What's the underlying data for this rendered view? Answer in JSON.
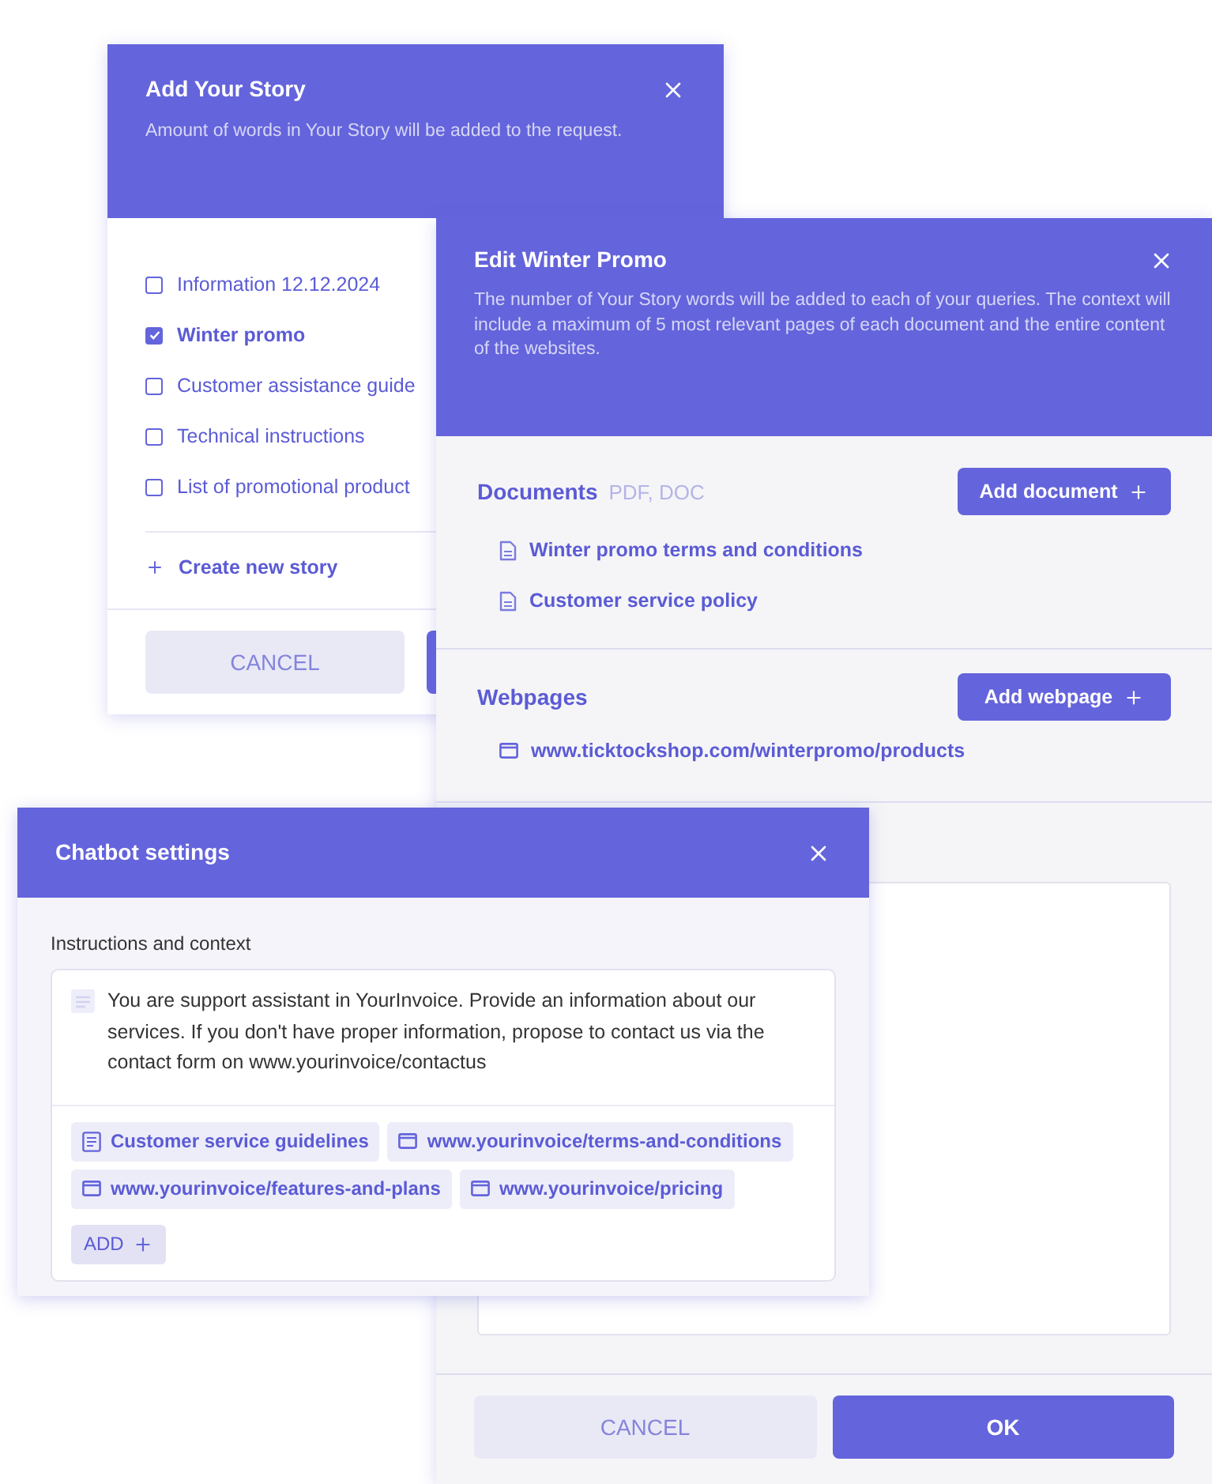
{
  "add_story_dialog": {
    "title": "Add Your Story",
    "description": "Amount of words in Your Story will be added to the request.",
    "stories": [
      {
        "label": "Information 12.12.2024",
        "checked": false
      },
      {
        "label": "Winter promo",
        "checked": true
      },
      {
        "label": "Customer assistance guide",
        "checked": false
      },
      {
        "label": "Technical instructions",
        "checked": false
      },
      {
        "label": "List of promotional product",
        "checked": false
      }
    ],
    "create_link": "Create new story",
    "buttons": [
      {
        "kind": "secondary",
        "label": "CANCEL"
      },
      {
        "kind": "primary"
      }
    ]
  },
  "edit_dialog": {
    "title": "Edit Winter Promo",
    "description": "The number of Your Story words will be added to each of your queries. The context will include a maximum of 5 most relevant pages of each document and the entire content of the websites.",
    "documents": {
      "heading": "Documents",
      "formats": "PDF, DOC",
      "button": "Add document",
      "items": [
        {
          "kind": "document",
          "label": "Winter promo terms and conditions"
        },
        {
          "kind": "document",
          "label": "Customer service policy"
        }
      ]
    },
    "webpages": {
      "heading": "Webpages",
      "button": "Add webpage",
      "items": [
        {
          "kind": "webpage",
          "label": "www.ticktockshop.com/winterpromo/products"
        }
      ]
    },
    "buttons": [
      {
        "kind": "secondary",
        "label": "CANCEL"
      },
      {
        "kind": "primary",
        "label": "OK"
      }
    ]
  },
  "chatbot_dialog": {
    "title": "Chatbot settings",
    "field_label": "Instructions and context",
    "instructions": "You are support assistant in YourInvoice. Provide an information about our services. If you don't have proper information, propose to contact us via the contact form on www.yourinvoice/contactus",
    "attachments": [
      {
        "kind": "document",
        "label": "Customer service guidelines"
      },
      {
        "kind": "webpage",
        "label": "www.yourinvoice/terms-and-conditions"
      },
      {
        "kind": "webpage",
        "label": "www.yourinvoice/features-and-plans"
      },
      {
        "kind": "webpage",
        "label": "www.yourinvoice/pricing"
      }
    ],
    "add_button": "ADD"
  }
}
